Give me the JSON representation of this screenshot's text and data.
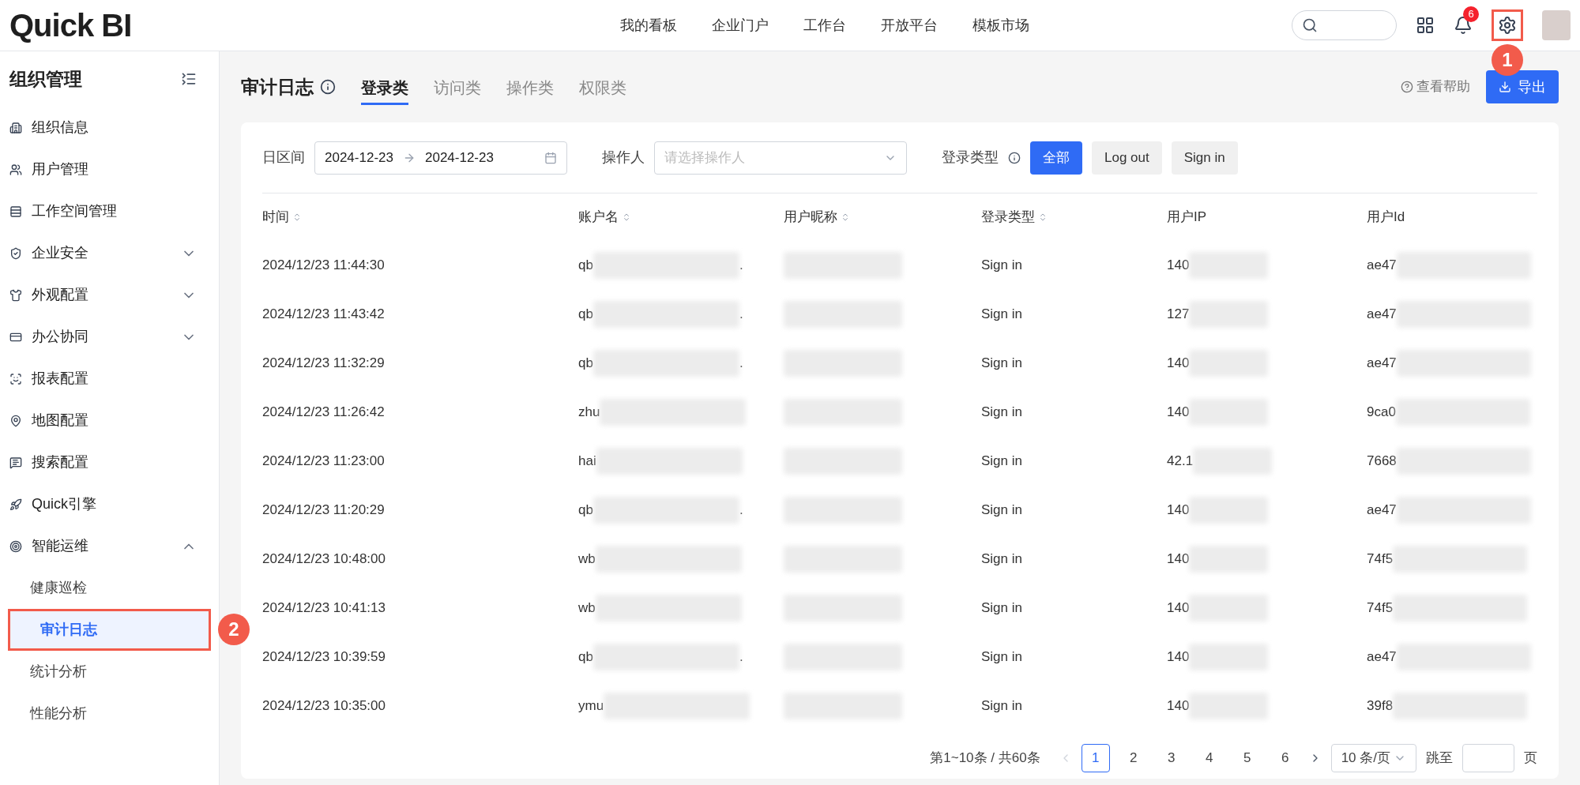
{
  "header": {
    "logo": "Quick BI",
    "nav": [
      "我的看板",
      "企业门户",
      "工作台",
      "开放平台",
      "模板市场"
    ],
    "notification_count": "6",
    "settings_annotation": "1"
  },
  "sidebar": {
    "title": "组织管理",
    "items": [
      {
        "label": "组织信息"
      },
      {
        "label": "用户管理"
      },
      {
        "label": "工作空间管理"
      },
      {
        "label": "企业安全",
        "expanded": false
      },
      {
        "label": "外观配置",
        "expanded": false
      },
      {
        "label": "办公协同",
        "expanded": false
      },
      {
        "label": "报表配置"
      },
      {
        "label": "地图配置"
      },
      {
        "label": "搜索配置"
      },
      {
        "label": "Quick引擎"
      },
      {
        "label": "智能运维",
        "expanded": true,
        "children": [
          {
            "label": "健康巡检",
            "selected": false
          },
          {
            "label": "审计日志",
            "selected": true,
            "annotation": "2"
          },
          {
            "label": "统计分析",
            "selected": false
          },
          {
            "label": "性能分析",
            "selected": false
          }
        ]
      }
    ]
  },
  "page": {
    "title": "审计日志",
    "tabs": [
      {
        "label": "登录类",
        "selected": true
      },
      {
        "label": "访问类",
        "selected": false
      },
      {
        "label": "操作类",
        "selected": false
      },
      {
        "label": "权限类",
        "selected": false
      }
    ],
    "help": "查看帮助",
    "export": "导出"
  },
  "filters": {
    "date_label": "日区间",
    "date_start": "2024-12-23",
    "date_end": "2024-12-23",
    "operator_label": "操作人",
    "operator_placeholder": "请选择操作人",
    "type_label": "登录类型",
    "type_options": [
      {
        "label": "全部",
        "selected": true
      },
      {
        "label": "Log out",
        "selected": false
      },
      {
        "label": "Sign in",
        "selected": false
      }
    ]
  },
  "table": {
    "columns": [
      {
        "label": "时间",
        "sortable": true
      },
      {
        "label": "账户名",
        "sortable": true
      },
      {
        "label": "用户昵称",
        "sortable": true
      },
      {
        "label": "登录类型",
        "sortable": true
      },
      {
        "label": "用户IP",
        "sortable": false
      },
      {
        "label": "用户Id",
        "sortable": false
      }
    ],
    "rows": [
      {
        "time": "2024/12/23 11:44:30",
        "account": "qb",
        "account_tail": ".",
        "type": "Sign in",
        "ip": "140",
        "user_id": "ae47"
      },
      {
        "time": "2024/12/23 11:43:42",
        "account": "qb",
        "account_tail": ".",
        "type": "Sign in",
        "ip": "127",
        "user_id": "ae47"
      },
      {
        "time": "2024/12/23 11:32:29",
        "account": "qb",
        "account_tail": ".",
        "type": "Sign in",
        "ip": "140",
        "user_id": "ae47"
      },
      {
        "time": "2024/12/23 11:26:42",
        "account": "zhu",
        "type": "Sign in",
        "ip": "140",
        "user_id": "9ca0"
      },
      {
        "time": "2024/12/23 11:23:00",
        "account": "hai",
        "type": "Sign in",
        "ip": "42.1",
        "user_id": "7668"
      },
      {
        "time": "2024/12/23 11:20:29",
        "account": "qb",
        "account_tail": ".",
        "type": "Sign in",
        "ip": "140",
        "user_id": "ae47"
      },
      {
        "time": "2024/12/23 10:48:00",
        "account": "wb",
        "type": "Sign in",
        "ip": "140",
        "user_id": "74f5"
      },
      {
        "time": "2024/12/23 10:41:13",
        "account": "wb",
        "type": "Sign in",
        "ip": "140",
        "user_id": "74f5"
      },
      {
        "time": "2024/12/23 10:39:59",
        "account": "qb",
        "account_tail": ".",
        "type": "Sign in",
        "ip": "140",
        "user_id": "ae47"
      },
      {
        "time": "2024/12/23 10:35:00",
        "account": "ymu",
        "type": "Sign in",
        "ip": "140",
        "user_id": "39f8"
      }
    ]
  },
  "pagination": {
    "summary": "第1~10条 / 共60条",
    "pages": [
      {
        "label": "1",
        "selected": true
      },
      {
        "label": "2",
        "selected": false
      },
      {
        "label": "3",
        "selected": false
      },
      {
        "label": "4",
        "selected": false
      },
      {
        "label": "5",
        "selected": false
      },
      {
        "label": "6",
        "selected": false
      }
    ],
    "page_size": "10 条/页",
    "jump_label": "跳至",
    "jump_unit": "页"
  }
}
